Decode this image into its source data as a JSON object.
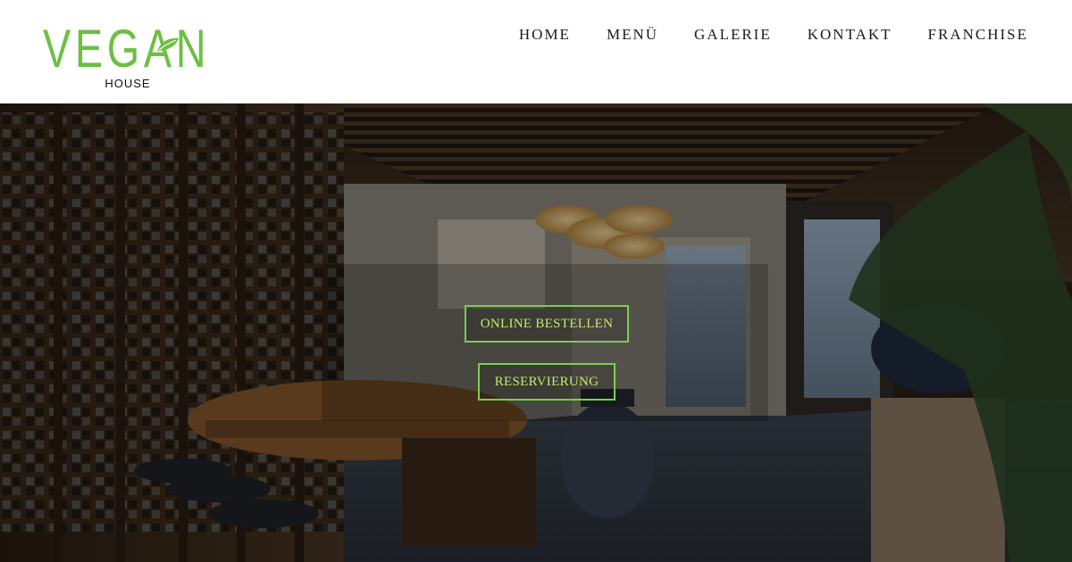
{
  "brand": {
    "name": "VEGAN",
    "subtitle": "HOUSE",
    "accent_color": "#6cbf45"
  },
  "nav": {
    "items": [
      {
        "label": "HOME"
      },
      {
        "label": "MENÜ"
      },
      {
        "label": "GALERIE"
      },
      {
        "label": "KONTAKT"
      },
      {
        "label": "FRANCHISE"
      }
    ]
  },
  "hero": {
    "primary_button": "ONLINE BESTELLEN",
    "secondary_button": "RESERVIERUNG",
    "button_border_color": "#7bcf4e",
    "button_text_color": "#c8e96a"
  }
}
